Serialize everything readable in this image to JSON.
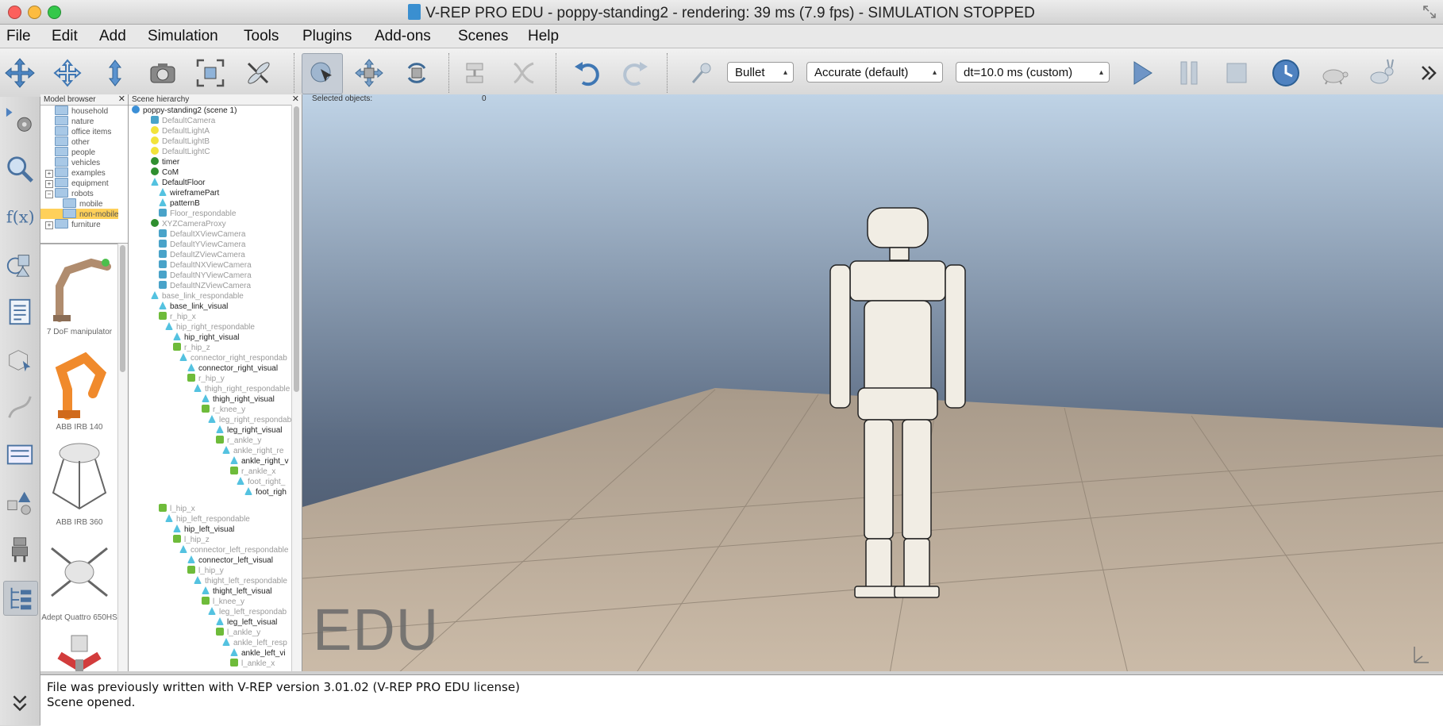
{
  "window": {
    "title": "V-REP PRO EDU - poppy-standing2 - rendering: 39 ms (7.9 fps) - SIMULATION STOPPED"
  },
  "menu": [
    "File",
    "Edit",
    "Add",
    "Simulation",
    "Tools",
    "Plugins",
    "Add-ons",
    "Scenes",
    "Help"
  ],
  "toolbar": {
    "engine": "Bullet",
    "accuracy": "Accurate (default)",
    "timestep": "dt=10.0 ms (custom)"
  },
  "model_browser": {
    "header": "Model browser",
    "folders": [
      "household",
      "nature",
      "office items",
      "other",
      "people",
      "vehicles",
      "examples",
      "equipment",
      "robots",
      "mobile",
      "non-mobile",
      "furniture"
    ],
    "models": [
      "7 DoF manipulator",
      "ABB IRB 140",
      "ABB IRB 360",
      "Adept Quattro 650HS"
    ]
  },
  "scene_hierarchy": {
    "header": "Scene hierarchy",
    "items": [
      "poppy-standing2 (scene 1)",
      "DefaultCamera",
      "DefaultLightA",
      "DefaultLightB",
      "DefaultLightC",
      "timer",
      "CoM",
      "DefaultFloor",
      "wireframePart",
      "patternB",
      "Floor_respondable",
      "XYZCameraProxy",
      "DefaultXViewCamera",
      "DefaultYViewCamera",
      "DefaultZViewCamera",
      "DefaultNXViewCamera",
      "DefaultNYViewCamera",
      "DefaultNZViewCamera",
      "base_link_respondable",
      "base_link_visual",
      "r_hip_x",
      "hip_right_respondable",
      "hip_right_visual",
      "r_hip_z",
      "connector_right_respondab",
      "connector_right_visual",
      "r_hip_y",
      "thigh_right_respondable",
      "thigh_right_visual",
      "r_knee_y",
      "leg_right_respondab",
      "leg_right_visual",
      "r_ankle_y",
      "ankle_right_re",
      "ankle_right_v",
      "r_ankle_x",
      "foot_right_",
      "foot_righ",
      "l_hip_x",
      "hip_left_respondable",
      "hip_left_visual",
      "l_hip_z",
      "connector_left_respondable",
      "connector_left_visual",
      "l_hip_y",
      "thight_left_respondable",
      "thight_left_visual",
      "l_knee_y",
      "leg_left_respondab",
      "leg_left_visual",
      "l_ankle_y",
      "ankle_left_resp",
      "ankle_left_vi",
      "l_ankle_x"
    ]
  },
  "viewport": {
    "selected_label": "Selected objects:",
    "selected_count": "0",
    "watermark": "EDU"
  },
  "console": [
    "File was previously written with V-REP version 3.01.02 (V-REP PRO EDU license)",
    "Scene opened."
  ]
}
